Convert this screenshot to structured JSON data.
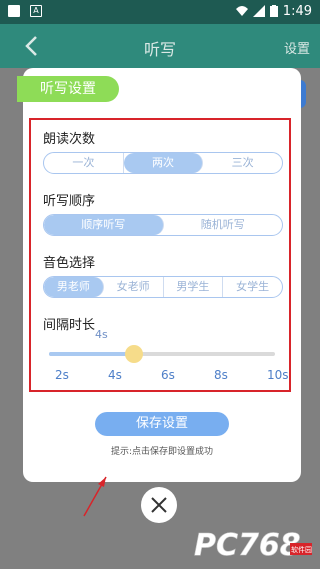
{
  "status_bar": {
    "time": "1:49"
  },
  "app_bar": {
    "title": "听写",
    "settings_label": "设置"
  },
  "dialog": {
    "tab_title": "听写设置",
    "read_count": {
      "label": "朗读次数",
      "options": [
        "一次",
        "两次",
        "三次"
      ],
      "selected_index": 1
    },
    "order": {
      "label": "听写顺序",
      "options": [
        "顺序听写",
        "随机听写"
      ],
      "selected_index": 0
    },
    "voice": {
      "label": "音色选择",
      "options": [
        "男老师",
        "女老师",
        "男学生",
        "女学生"
      ],
      "selected_index": 0
    },
    "interval": {
      "label": "间隔时长",
      "value_text": "4s",
      "ticks": [
        "2s",
        "4s",
        "6s",
        "8s",
        "10s"
      ],
      "slider_fraction": 0.375
    },
    "save_button": "保存设置",
    "hint": "提示:点击保存即设置成功"
  },
  "colors": {
    "app_bar": "#2f8a7c",
    "accent_green": "#8edc57",
    "accent_blue": "#78aef0",
    "highlight_red": "#d8242a"
  },
  "watermark": {
    "text": "PC768",
    "sub": "软件园"
  }
}
